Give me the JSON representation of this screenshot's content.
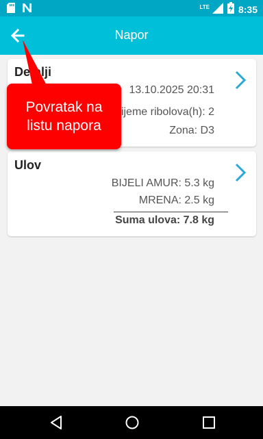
{
  "status_bar": {
    "time": "8:35",
    "network_label": "LTE",
    "icons": [
      "sd-card-icon",
      "n-notification-icon",
      "signal-icon",
      "battery-charging-icon"
    ]
  },
  "app_bar": {
    "title": "Napor",
    "back_icon": "arrow-left-icon"
  },
  "details_card": {
    "title": "Detalji",
    "date": "13.10.2025 20:31",
    "fishing_time": "Vrijeme ribolova(h): 2",
    "zone": "Zona: D3",
    "chevron_icon": "chevron-right-icon"
  },
  "catch_card": {
    "title": "Ulov",
    "rows": [
      {
        "label": "BIJELI AMUR: 5.3 kg"
      },
      {
        "label": "MRENA: 2.5 kg"
      }
    ],
    "sum": "Suma ulova: 7.8 kg",
    "chevron_icon": "chevron-right-icon"
  },
  "tooltip": {
    "line1": "Povratak na",
    "line2": "listu napora"
  },
  "nav_bar": {
    "icons": [
      "back-triangle-icon",
      "home-circle-icon",
      "recents-square-icon"
    ]
  },
  "colors": {
    "status_bar": "#00a7c4",
    "app_bar": "#00bfd9",
    "accent": "#2aa8d8",
    "tooltip": "#ff0000",
    "background": "#f2f2f2"
  }
}
